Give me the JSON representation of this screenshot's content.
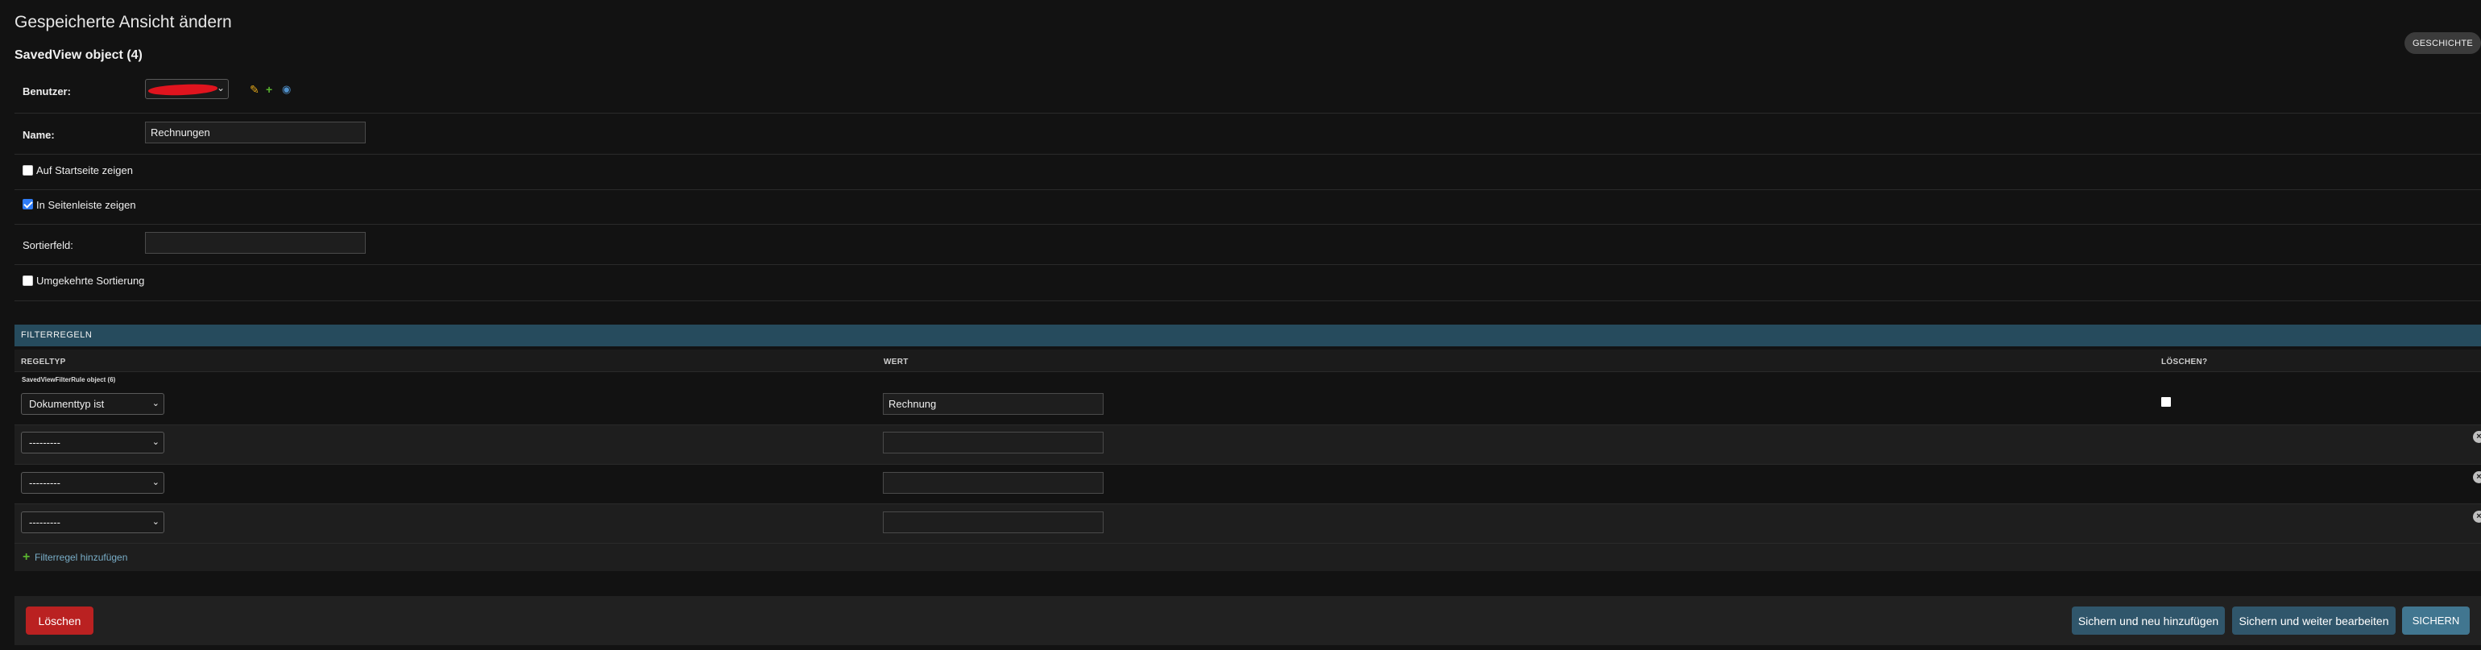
{
  "page": {
    "title": "Gespeicherte Ansicht ändern",
    "history_label": "GESCHICHTE",
    "object_title": "SavedView object (4)"
  },
  "fields": {
    "user": {
      "label": "Benutzer:",
      "icons": [
        "pencil-icon",
        "plus-icon",
        "eye-icon"
      ]
    },
    "name": {
      "label": "Name:",
      "value": "Rechnungen"
    },
    "show_on_dashboard": {
      "label": "Auf Startseite zeigen",
      "checked": false
    },
    "show_in_sidebar": {
      "label": "In Seitenleiste zeigen",
      "checked": true
    },
    "sort_field": {
      "label": "Sortierfeld:",
      "value": ""
    },
    "sort_reverse": {
      "label": "Umgekehrte Sortierung",
      "checked": false
    }
  },
  "filter_rules": {
    "header": "FILTERREGELN",
    "columns": {
      "rule_type": "REGELTYP",
      "value": "WERT",
      "delete": "LÖSCHEN?"
    },
    "existing_caption": "SavedViewFilterRule object (6)",
    "rows": [
      {
        "rule_type": "Dokumenttyp ist",
        "value": "Rechnung",
        "existing": true
      },
      {
        "rule_type": "---------",
        "value": "",
        "existing": false
      },
      {
        "rule_type": "---------",
        "value": "",
        "existing": false
      },
      {
        "rule_type": "---------",
        "value": "",
        "existing": false
      }
    ],
    "add_label": "Filterregel hinzufügen"
  },
  "actions": {
    "delete": "Löschen",
    "save_and_add": "Sichern und neu hinzufügen",
    "save_and_continue": "Sichern und weiter bearbeiten",
    "save": "SICHERN"
  },
  "colors": {
    "background": "#121212",
    "inline_header": "#264b5d",
    "delete_button": "#ba2121",
    "secondary_button": "#30566b",
    "save_button": "#417690",
    "link": "#79aec8",
    "add_plus": "#59b42f"
  }
}
